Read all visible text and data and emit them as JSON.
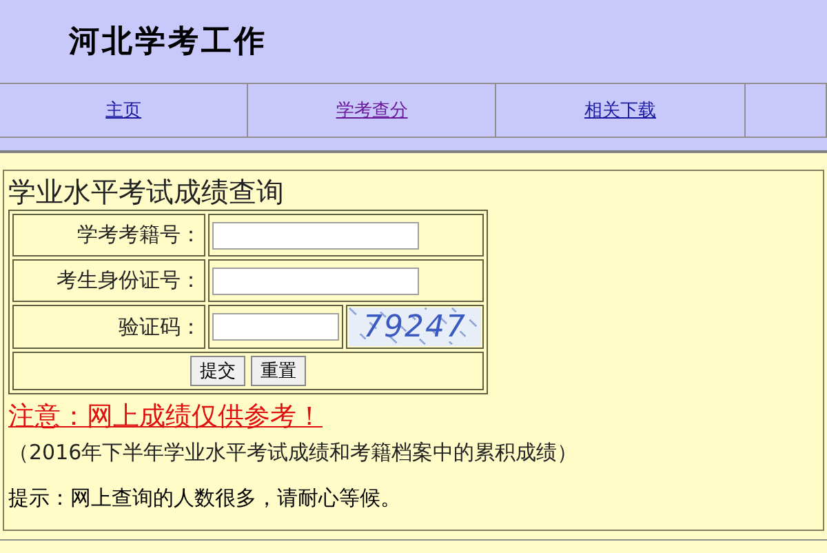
{
  "header": {
    "title": "河北学考工作"
  },
  "nav": [
    {
      "label": "主页"
    },
    {
      "label": "学考查分"
    },
    {
      "label": "相关下载"
    }
  ],
  "form": {
    "title": "学业水平考试成绩查询",
    "fields": [
      {
        "label": "学考考籍号：",
        "kind": "text"
      },
      {
        "label": "考生身份证号：",
        "kind": "text"
      },
      {
        "label": "验证码：",
        "kind": "captcha",
        "captcha": "79247"
      }
    ],
    "buttons": [
      "提交",
      "重置"
    ]
  },
  "notice": "注意：网上成绩仅供参考！",
  "note": "（2016年下半年学业水平考试成绩和考籍档案中的累积成绩）",
  "hint": "提示：网上查询的人数很多，请耐心等候。"
}
